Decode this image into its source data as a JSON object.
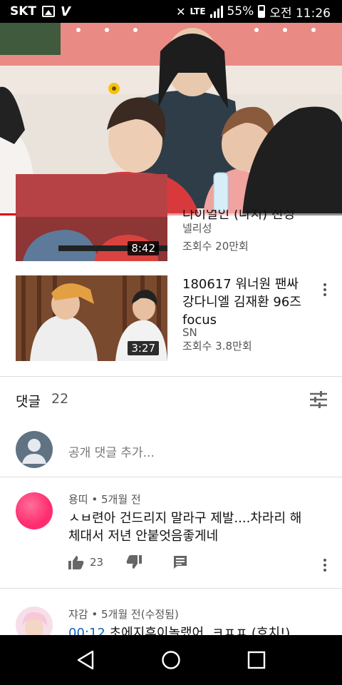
{
  "status_bar": {
    "carrier": "SKT",
    "battery": "55%",
    "time": "오전 11:26"
  },
  "player": {
    "progress": 0.32,
    "progress_color": "#e00000"
  },
  "videos": [
    {
      "title_partial": "다이얼인 (다치) 천싱",
      "channel": "넬리성",
      "views": "조회수 20만회",
      "duration": "8:42"
    },
    {
      "title": "180617 워너원 팬싸 강다니엘 김재환 96즈 focus",
      "channel": "SN",
      "views": "조회수 3.8만회",
      "duration": "3:27"
    }
  ],
  "comments_section": {
    "title": "댓글",
    "count": "22",
    "add_placeholder": "공개 댓글 추가...",
    "sort_icon": "sort-icon"
  },
  "comments": [
    {
      "author": "용띠",
      "age": "5개월 전",
      "text": "ㅅㅂ련아 건드리지 말라구 제발....차라리 해체대서 저년 안붙엇음좋게네",
      "likes": "23",
      "avatar_color": "#ff2d6f"
    },
    {
      "author": "쟈감",
      "age": "5개월 전(수정됨)",
      "timestamp": "00:12",
      "text": "초에지후이놀랬어. ㅋㅍㅍ (흐치!)"
    }
  ],
  "nav": {
    "back": "back-icon",
    "home": "home-icon",
    "recents": "recents-icon"
  }
}
